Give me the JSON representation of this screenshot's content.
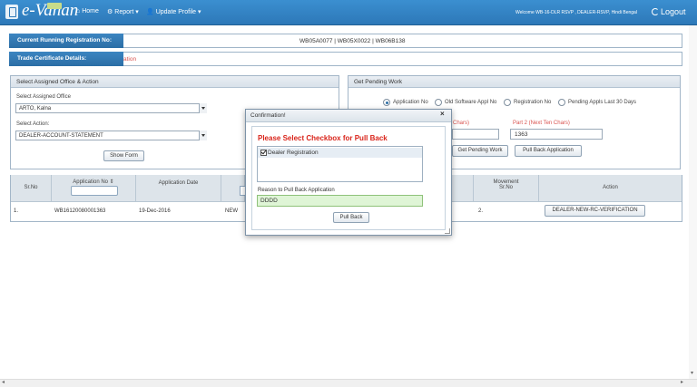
{
  "nav": {
    "logo": "e-Vahan",
    "home": "Home",
    "report": "Report",
    "update_profile": "Update Profile",
    "welcome": "Welcome WB-16-DLR RSVP , DEALER-RSVP, Hindi Bengal",
    "logout": "Logout"
  },
  "running_registration": {
    "label": "Current Running Registration No:",
    "values": "WB05A0077 | WB05X0022 | WB06B138"
  },
  "trade_certificate": {
    "label": "Trade Certificate Details:",
    "extra": "ation"
  },
  "office_panel": {
    "title": "Select Assigned Office & Action",
    "office_label": "Select Assigned Office",
    "office_value": "ARTO, Kalna",
    "action_label": "Select Action:",
    "action_value": "DEALER-ACCOUNT-STATEMENT",
    "show_form": "Show Form"
  },
  "pending_panel": {
    "title": "Get Pending Work",
    "radio_options": [
      "Application No",
      "Old Software Appl No",
      "Registration No",
      "Pending Appls Last 30 Days"
    ],
    "part1_label_fragment": "Chars)",
    "part2_label": "Part 2 (Next Ten Chars)",
    "part2_value": "1363",
    "get_pending_work": "Get Pending Work",
    "pull_back_application": "Pull Back Application"
  },
  "table": {
    "headers": {
      "sr_no": "Sr.No",
      "application_no": "Application No",
      "application_date": "Application Date",
      "movement_sr_no": "Movement Sr.No",
      "action": "Action"
    },
    "rows": [
      {
        "sr_no": "1.",
        "application_no": "WB16120080001363",
        "application_date": "19-Dec-2016",
        "status": "NEW",
        "movement_sr_no": "2.",
        "action": "DEALER-NEW-RC-VERIFICATION"
      }
    ]
  },
  "modal": {
    "title": "Confirmation!",
    "close": "×",
    "warning": "Please Select Checkbox for Pull Back",
    "checkbox_label": "Dealer Registration",
    "reason_label": "Reason to Pull Back Application",
    "reason_value": "DDDD",
    "pull_back": "Pull Back"
  },
  "colors": {
    "navbar": "#2d78b8",
    "label_bar": "#2b6ea5",
    "warning": "#d9241a",
    "reason_bg": "#dff5d6"
  }
}
